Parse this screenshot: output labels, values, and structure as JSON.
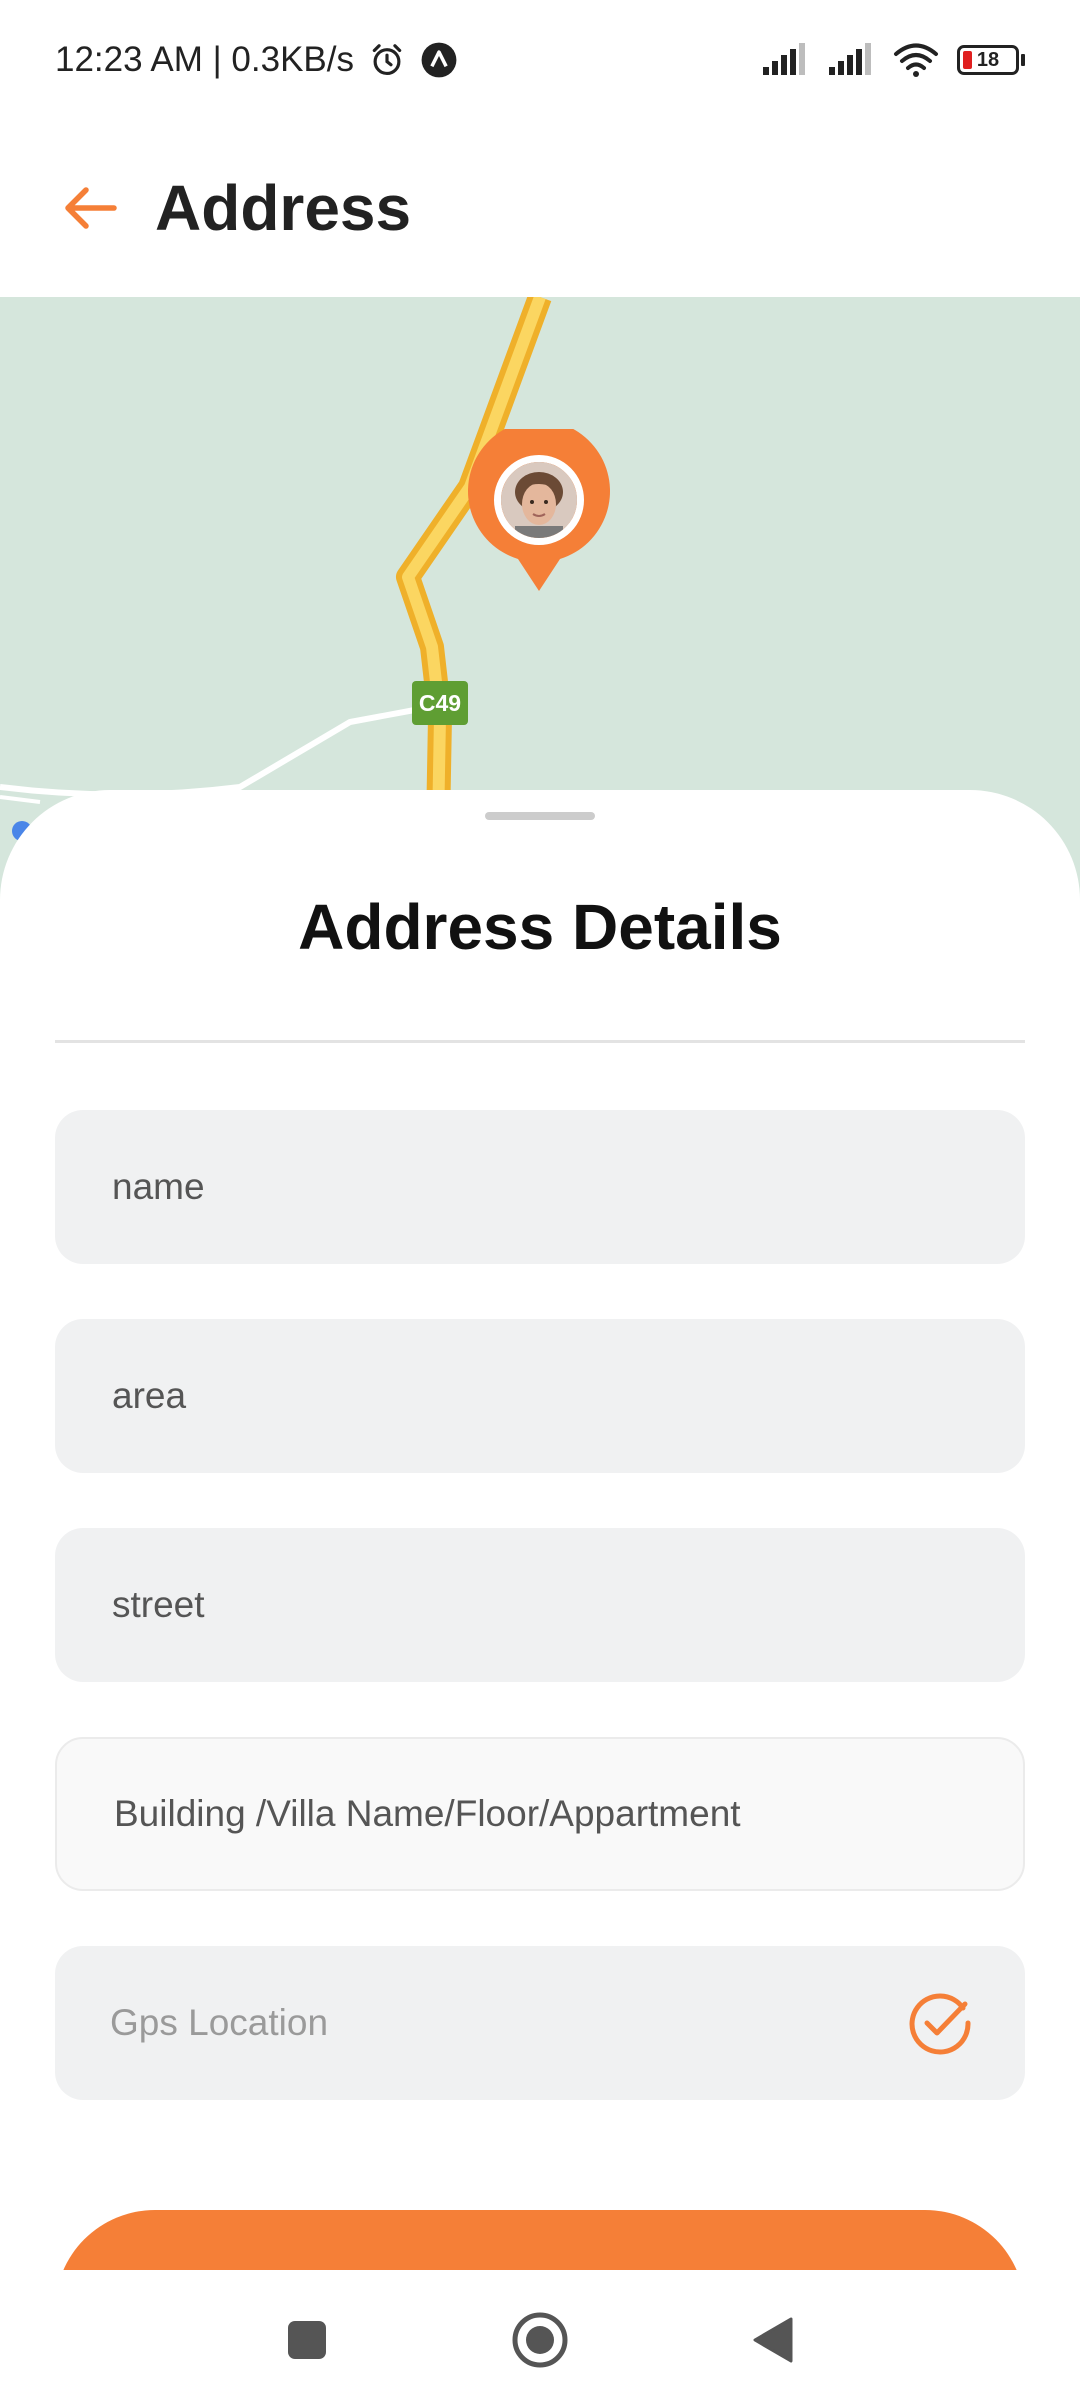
{
  "status_bar": {
    "time_info": "12:23 AM | 0.3KB/s",
    "battery_level": "18"
  },
  "header": {
    "title": "Address"
  },
  "map": {
    "road_label": "C49"
  },
  "sheet": {
    "title": "Address Details",
    "fields": {
      "name_placeholder": "name",
      "area_placeholder": "area",
      "street_placeholder": "street",
      "building_placeholder": "Building /Villa Name/Floor/Appartment",
      "gps_placeholder": "Gps Location"
    }
  },
  "colors": {
    "accent": "#f57f37",
    "map_background": "#d5e6dc",
    "road": "#f7c545",
    "field_background": "#f0f1f2"
  },
  "icons": {
    "back": "arrow-left-icon",
    "gps_status": "check-circle-icon",
    "nav_recents": "square-icon",
    "nav_home": "circle-icon",
    "nav_back": "triangle-back-icon"
  }
}
